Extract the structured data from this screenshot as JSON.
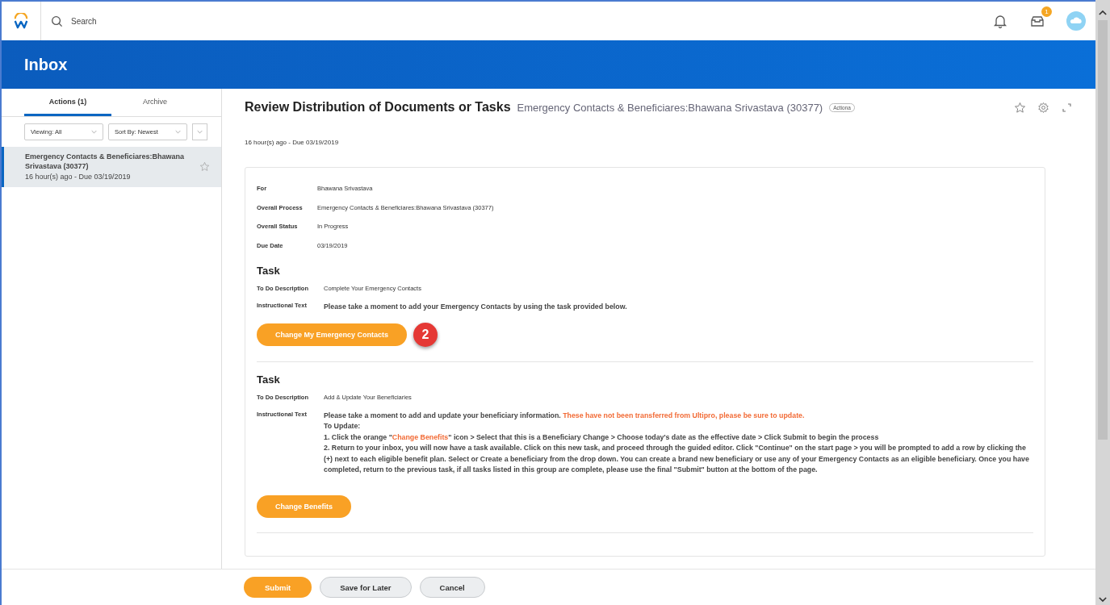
{
  "topbar": {
    "search": {
      "placeholder": "Search"
    },
    "inbox_badge": "1"
  },
  "header": {
    "title": "Inbox"
  },
  "sidebar": {
    "tabs": [
      {
        "label": "Actions (1)",
        "selected": true
      },
      {
        "label": "Archive",
        "selected": false
      }
    ],
    "filters": [
      {
        "label": "Viewing: All"
      },
      {
        "label": "Sort By: Newest"
      }
    ],
    "items": [
      {
        "title": "Emergency Contacts & Beneficiares:Bhawana Srivastava (30377)",
        "meta": "16 hour(s) ago - Due 03/19/2019",
        "selected": true
      }
    ]
  },
  "content": {
    "title": "Review Distribution of Documents or Tasks",
    "subtitle": "Emergency Contacts & Beneficiares:Bhawana Srivastava (30377)",
    "badge": "Actiona",
    "meta": "16 hour(s) ago - Due 03/19/2019",
    "details": [
      {
        "label": "For",
        "value": "Bhawana Srivastava"
      },
      {
        "label": "Overall Process",
        "value": "Emergency Contacts & Beneficiares:Bhawana Srivastava (30377)"
      },
      {
        "label": "Overall Status",
        "value": "In Progress"
      },
      {
        "label": "Due Date",
        "value": "03/19/2019"
      }
    ],
    "tasks": [
      {
        "heading": "Task",
        "description_label": "To Do Description",
        "description": "Complete Your Emergency Contacts",
        "instruction_label": "Instructional Text",
        "instruction": [
          [
            {
              "text": "Please take a moment to add your Emergency Contacts by using the task provided below.",
              "kind": "plain"
            }
          ]
        ],
        "button": "Change My Emergency Contacts",
        "callout": "2"
      },
      {
        "heading": "Task",
        "description_label": "To Do Description",
        "description": "Add & Update Your Beneficiaries",
        "instruction_label": "Instructional Text",
        "instruction": [
          [
            {
              "text": "Please take a moment to add and update your beneficiary information. ",
              "kind": "plain"
            },
            {
              "text": "These have not been transferred from Ultipro, please be sure to update.",
              "kind": "highlight"
            }
          ],
          [
            {
              "text": "To Update:",
              "kind": "plain"
            }
          ],
          [
            {
              "text": "1. Click the orange \"",
              "kind": "plain"
            },
            {
              "text": "Change Benefits",
              "kind": "highlight"
            },
            {
              "text": "\" icon > Select that this is a Beneficiary Change > Choose today's date as the effective date > Click Submit to begin the process",
              "kind": "plain"
            }
          ],
          [
            {
              "text": "2. Return to your inbox, you will now have a task available. Click on this new task, and proceed through the guided editor. Click \"Continue\" on the start page > you will be prompted to add a row by clicking the (+) next to each eligible benefit plan. Select or Create a beneficiary from the drop down. You can create a brand new beneficiary or use any of your Emergency Contacts as an eligible beneficiary. Once you have completed, return to the previous task, if all tasks listed in this group are complete, please use the final \"Submit\" button at the bottom of the page.",
              "kind": "plain"
            }
          ]
        ],
        "button": "Change Benefits"
      }
    ]
  },
  "footer": {
    "buttons": [
      {
        "label": "Submit",
        "kind": "primary"
      },
      {
        "label": "Save for Later",
        "kind": "secondary"
      },
      {
        "label": "Cancel",
        "kind": "secondary"
      }
    ]
  }
}
